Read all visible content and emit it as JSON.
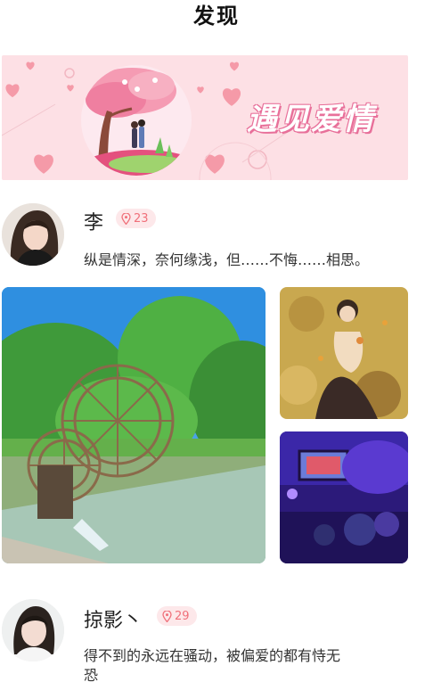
{
  "header": {
    "title": "发现"
  },
  "banner": {
    "text": "遇见爱情"
  },
  "posts": [
    {
      "username": "李",
      "location_count": "23",
      "content": "纵是情深，奈何缘浅，但……不悔……相思。",
      "icon": "location-pin-icon"
    },
    {
      "username": "掠影丶",
      "location_count": "29",
      "content_line1": "得不到的永远在骚动，被偏爱的都有恃无",
      "content_line2": "恐",
      "icon": "location-pin-icon"
    }
  ],
  "colors": {
    "badge_bg": "#fde8ea",
    "badge_text": "#f0707a",
    "banner_bg": "#fde0e5"
  }
}
